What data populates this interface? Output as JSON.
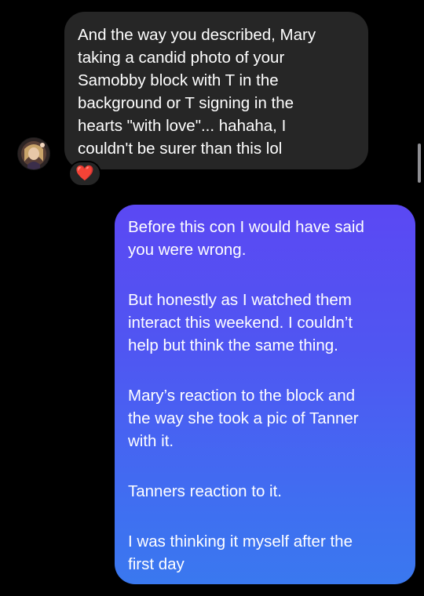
{
  "conversation": {
    "incoming": {
      "text": "And the way you described, Mary\ntaking a candid photo of your\nSamobby block with T in the\nbackground or T signing in the\nhearts \"with love\"... hahaha, I\ncouldn't be surer than this lol",
      "reaction": "❤️",
      "avatar": "profile-photo"
    },
    "outgoing": {
      "paragraphs": [
        "Before this con I would have said\nyou were wrong.",
        "But honestly as I watched them\ninteract this weekend. I couldn’t\nhelp but think the same thing.",
        "Mary’s reaction to the block and\nthe way she took a pic of Tanner\nwith it.",
        "Tanners reaction to it.",
        "I was thinking it myself after the\nfirst day"
      ]
    }
  },
  "colors": {
    "background": "#000000",
    "incoming_bubble": "#262626",
    "outgoing_gradient_top": "#5b48f3",
    "outgoing_gradient_bottom": "#3a78ef",
    "reaction_heart": "#ff2b3d"
  }
}
